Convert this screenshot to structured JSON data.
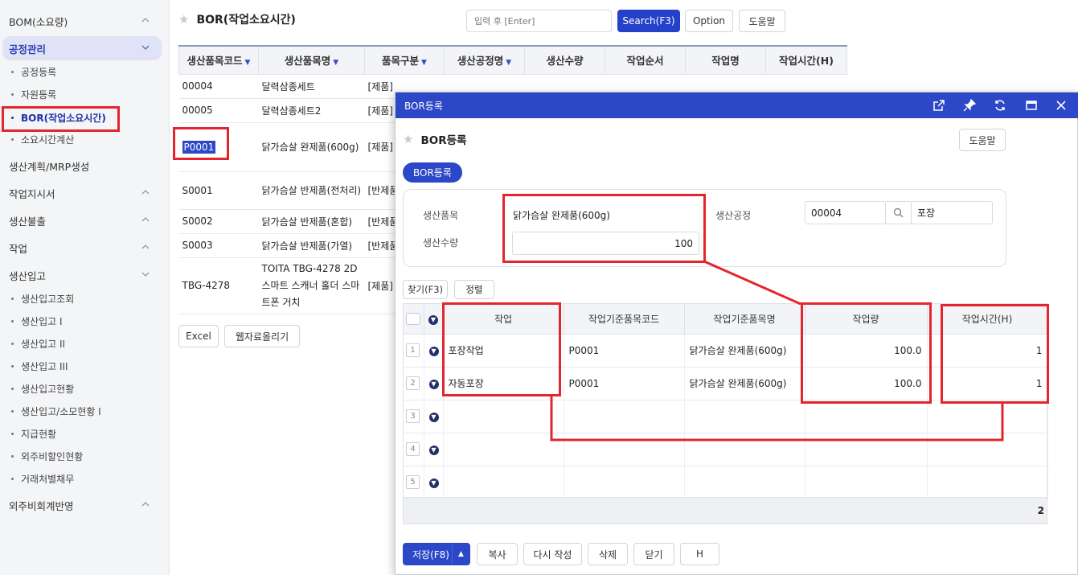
{
  "sidebar": {
    "groups": [
      {
        "label": "BOM(소요량)"
      },
      {
        "label": "공정관리"
      },
      {
        "label": "생산계획/MRP생성"
      },
      {
        "label": "작업지시서"
      },
      {
        "label": "생산불출"
      },
      {
        "label": "작업"
      },
      {
        "label": "생산입고"
      },
      {
        "label": "외주비회계반영"
      }
    ],
    "process_items": [
      "공정등록",
      "자원등록",
      "BOR(작업소요시간)",
      "소요시간계산"
    ],
    "receipt_items": [
      "생산입고조회",
      "생산입고 I",
      "생산입고 II",
      "생산입고 III",
      "생산입고현황",
      "생산입고/소모현황 I",
      "지급현황",
      "외주비할인현황",
      "거래처별채무"
    ]
  },
  "page": {
    "title": "BOR(작업소요시간)",
    "search_placeholder": "입력 후 [Enter]",
    "search_button": "Search(F3)",
    "option_button": "Option",
    "help_button": "도움말",
    "columns": [
      "생산품목코드",
      "생산품목명",
      "품목구분",
      "생산공정명",
      "생산수량",
      "작업순서",
      "작업명",
      "작업시간(H)"
    ],
    "rows": [
      {
        "code": "00004",
        "name": "달력삼종세트",
        "type": "[제품]"
      },
      {
        "code": "00005",
        "name": "달력삼종세트2",
        "type": "[제품]"
      },
      {
        "code": "P0001",
        "name": "닭가슴살 완제품(600g)",
        "type": "[제품]"
      },
      {
        "code": "S0001",
        "name": "닭가슴살 반제품(전처리)",
        "type": "[반제품]"
      },
      {
        "code": "S0002",
        "name": "닭가슴살 반제품(혼합)",
        "type": "[반제품]"
      },
      {
        "code": "S0003",
        "name": "닭가슴살 반제품(가열)",
        "type": "[반제품]"
      },
      {
        "code": "TBG-4278",
        "name": "TOITA TBG-4278 2D 스마트 스캐너 홀더 스마트폰 거치",
        "type": "[제품]"
      }
    ],
    "excel_button": "Excel",
    "web_upload_button": "웹자료올리기"
  },
  "modal": {
    "window_title": "BOR등록",
    "title": "BOR등록",
    "help_button": "도움말",
    "tab_label": "BOR등록",
    "form": {
      "item_label": "생산품목",
      "item_value": "닭가슴살 완제품(600g)",
      "qty_label": "생산수량",
      "qty_value": "100",
      "process_label": "생산공정",
      "process_code": "00004",
      "process_name": "포장"
    },
    "find_button": "찾기(F3)",
    "sort_button": "정렬",
    "grid_columns": [
      "작업",
      "작업기준품목코드",
      "작업기준품목명",
      "작업량",
      "작업시간(H)"
    ],
    "grid_rows": [
      {
        "no": "1",
        "task": "포장작업",
        "code": "P0001",
        "name": "닭가슴살 완제품(600g)",
        "amount": "100.0",
        "hours": "1"
      },
      {
        "no": "2",
        "task": "자동포장",
        "code": "P0001",
        "name": "닭가슴살 완제품(600g)",
        "amount": "100.0",
        "hours": "1"
      },
      {
        "no": "3",
        "task": "",
        "code": "",
        "name": "",
        "amount": "",
        "hours": ""
      },
      {
        "no": "4",
        "task": "",
        "code": "",
        "name": "",
        "amount": "",
        "hours": ""
      },
      {
        "no": "5",
        "task": "",
        "code": "",
        "name": "",
        "amount": "",
        "hours": ""
      }
    ],
    "footer_count": "2",
    "buttons": {
      "save": "저장(F8)",
      "copy": "복사",
      "rewrite": "다시 작성",
      "delete": "삭제",
      "close": "닫기",
      "h": "H"
    }
  },
  "colors": {
    "accent": "#2c47c8",
    "annotation": "#e3262d"
  }
}
